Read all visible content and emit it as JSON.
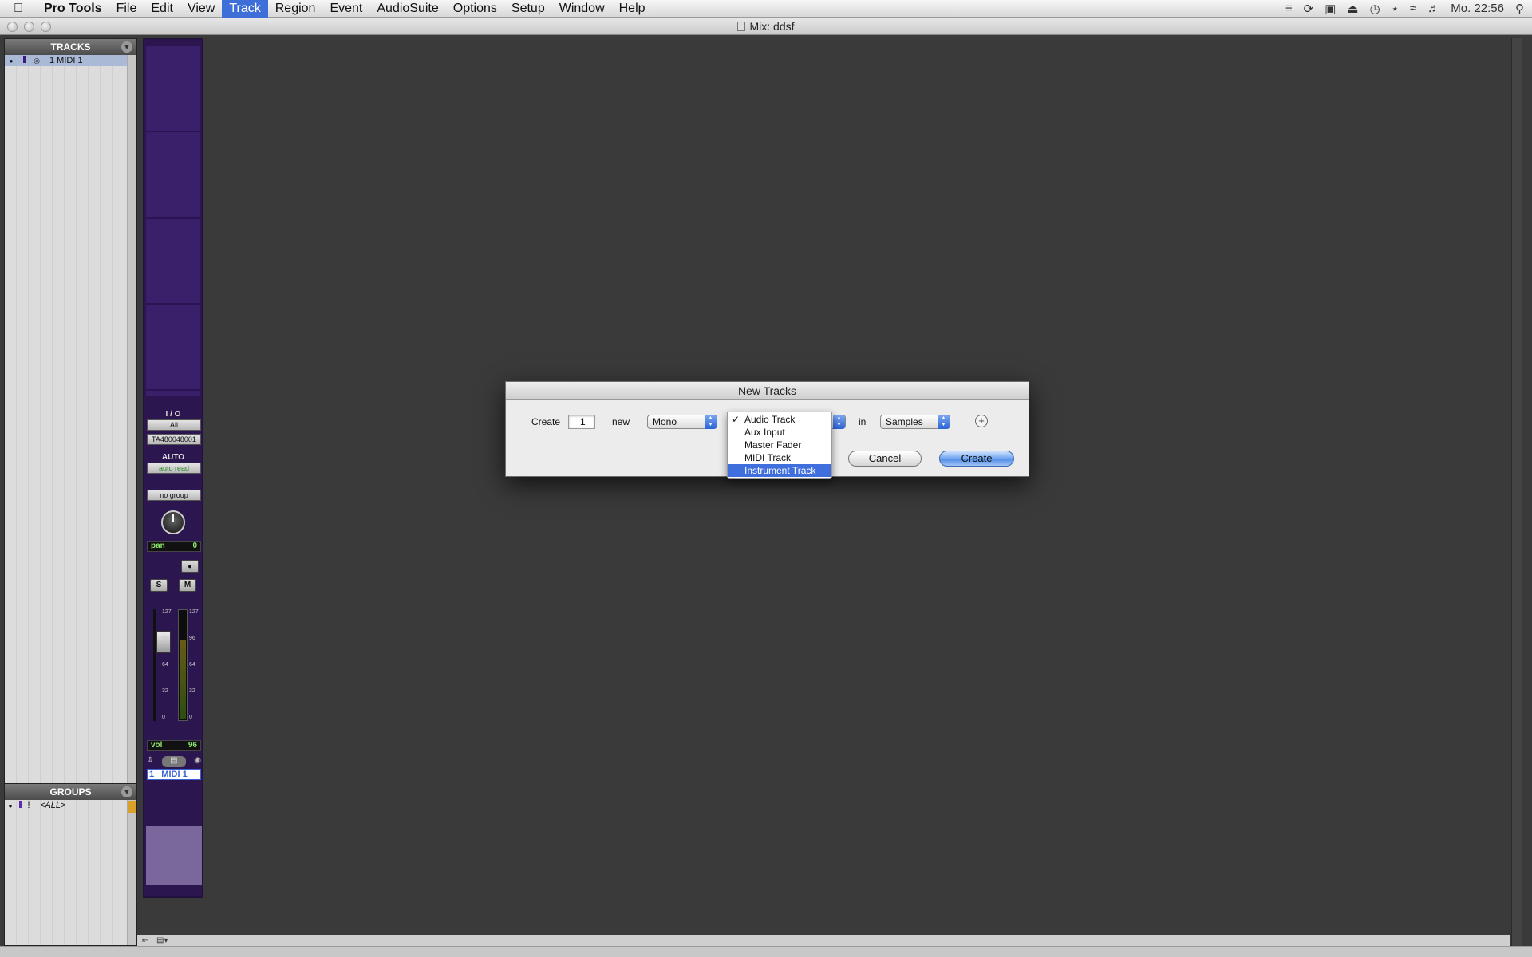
{
  "menubar": {
    "apple": "",
    "items": [
      "Pro Tools",
      "File",
      "Edit",
      "View",
      "Track",
      "Region",
      "Event",
      "AudioSuite",
      "Options",
      "Setup",
      "Window",
      "Help"
    ],
    "active_index": 4,
    "clock": "Mo. 22:56"
  },
  "window": {
    "title": "Mix: ddsf"
  },
  "tracks_panel": {
    "title": "TRACKS",
    "rows": [
      {
        "label": "1 MIDI 1"
      }
    ]
  },
  "groups_panel": {
    "title": "GROUPS",
    "rows": [
      {
        "marker": "!",
        "label": "<ALL>"
      }
    ]
  },
  "strip": {
    "io_label": "I / O",
    "input": "All",
    "output": "TA480048001",
    "auto_label": "AUTO",
    "auto_mode": "auto read",
    "group": "no group",
    "pan_label": "pan",
    "pan_value": "0",
    "solo": "S",
    "mute": "M",
    "fader_scale": [
      "127",
      "96",
      "64",
      "32",
      "0"
    ],
    "meter_scale": [
      "127",
      "96",
      "64",
      "32",
      "0"
    ],
    "meter_level": 0.72,
    "vol_label": "vol",
    "vol_value": "96",
    "track_number": "1",
    "track_name": "MIDI 1"
  },
  "dialog": {
    "title": "New Tracks",
    "create_label": "Create",
    "count": "1",
    "new_label": "new",
    "format": "Mono",
    "in_label": "in",
    "timebase": "Samples",
    "add_row": "+",
    "cancel": "Cancel",
    "create_button": "Create",
    "track_type_options": [
      {
        "label": "Audio Track",
        "checked": true
      },
      {
        "label": "Aux Input"
      },
      {
        "label": "Master Fader"
      },
      {
        "label": "MIDI Track"
      },
      {
        "label": "Instrument Track",
        "highlighted": true
      }
    ]
  },
  "colors": {
    "menu_highlight": "#3e6fd8",
    "strip_purple": "#2c1650",
    "dialog_default_button": "#4c8be6"
  }
}
